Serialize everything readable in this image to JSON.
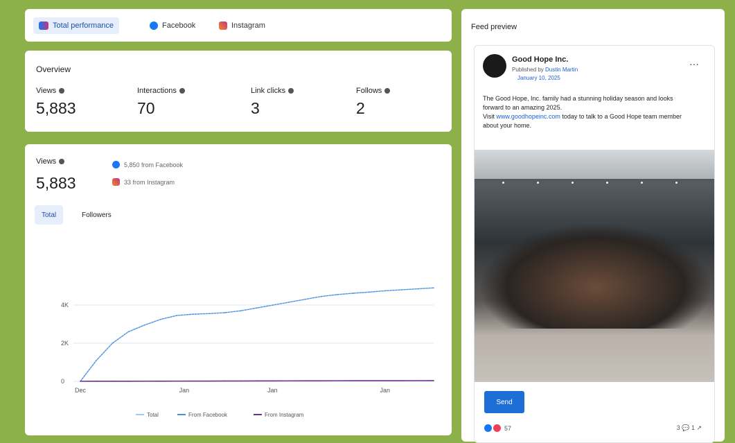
{
  "tabs": [
    {
      "label": "Total performance",
      "icon": "total-performance-icon"
    },
    {
      "label": "Facebook",
      "icon": "facebook-icon"
    },
    {
      "label": "Instagram",
      "icon": "instagram-icon"
    }
  ],
  "overview": {
    "title": "Overview",
    "metrics": [
      {
        "label": "Views",
        "value": "5,883"
      },
      {
        "label": "Interactions",
        "value": "70"
      },
      {
        "label": "Link clicks",
        "value": "3"
      },
      {
        "label": "Follows",
        "value": "2"
      }
    ]
  },
  "views": {
    "label": "Views",
    "value": "5,883",
    "facebook_source": "5,850 from Facebook",
    "instagram_source": "33 from Instagram",
    "segments": [
      "Total",
      "Followers"
    ]
  },
  "chart_data": {
    "type": "line",
    "x_ticks": [
      "Dec",
      "Jan",
      "Jan",
      "Jan"
    ],
    "y_ticks": [
      "0",
      "2K",
      "4K"
    ],
    "ylim": [
      0,
      6000
    ],
    "x": [
      0,
      2,
      4,
      6,
      8,
      10,
      12,
      14,
      16,
      18,
      20,
      22,
      24,
      26,
      28,
      30,
      32,
      34,
      36,
      38,
      40,
      42,
      44
    ],
    "series": [
      {
        "name": "Total",
        "values": [
          0,
          1100,
          2000,
          2600,
          2950,
          3250,
          3450,
          3520,
          3550,
          3600,
          3700,
          3850,
          4000,
          4150,
          4300,
          4450,
          4550,
          4620,
          4680,
          4750,
          4800,
          4850,
          4900
        ]
      },
      {
        "name": "From Facebook",
        "values": [
          0,
          1100,
          2000,
          2600,
          2950,
          3250,
          3450,
          3520,
          3550,
          3600,
          3700,
          3850,
          4000,
          4150,
          4300,
          4450,
          4550,
          4620,
          4680,
          4750,
          4800,
          4850,
          4900
        ]
      },
      {
        "name": "From Instagram",
        "values": [
          0,
          1,
          2,
          3,
          5,
          7,
          9,
          11,
          13,
          15,
          17,
          19,
          21,
          23,
          25,
          26,
          27,
          28,
          29,
          30,
          31,
          32,
          33
        ]
      }
    ],
    "colors": [
      "#9ecaf5",
      "#4a90d9",
      "#6b2f8f"
    ],
    "grid": true,
    "legend": "bottom"
  },
  "feed": {
    "title": "Feed preview",
    "page_name": "Good Hope Inc.",
    "author_prefix": "Published by ",
    "author": "Dustin Martin",
    "date": "January 10, 2025",
    "text_1": "The Good Hope, Inc. family had a stunning holiday season and looks forward to an amazing 2025.",
    "text_2_prefix": "Visit ",
    "link": "www.goodhopeinc.com",
    "text_2_suffix": " today to talk to a Good Hope team member about your home.",
    "send_label": "Send",
    "reactions_count": "57",
    "counts": "3 💬 1 ↗"
  },
  "colors": {
    "accent": "#1b4fa8",
    "background": "#8db04a",
    "facebook": "#1877f2",
    "instagram": "#c13584"
  }
}
